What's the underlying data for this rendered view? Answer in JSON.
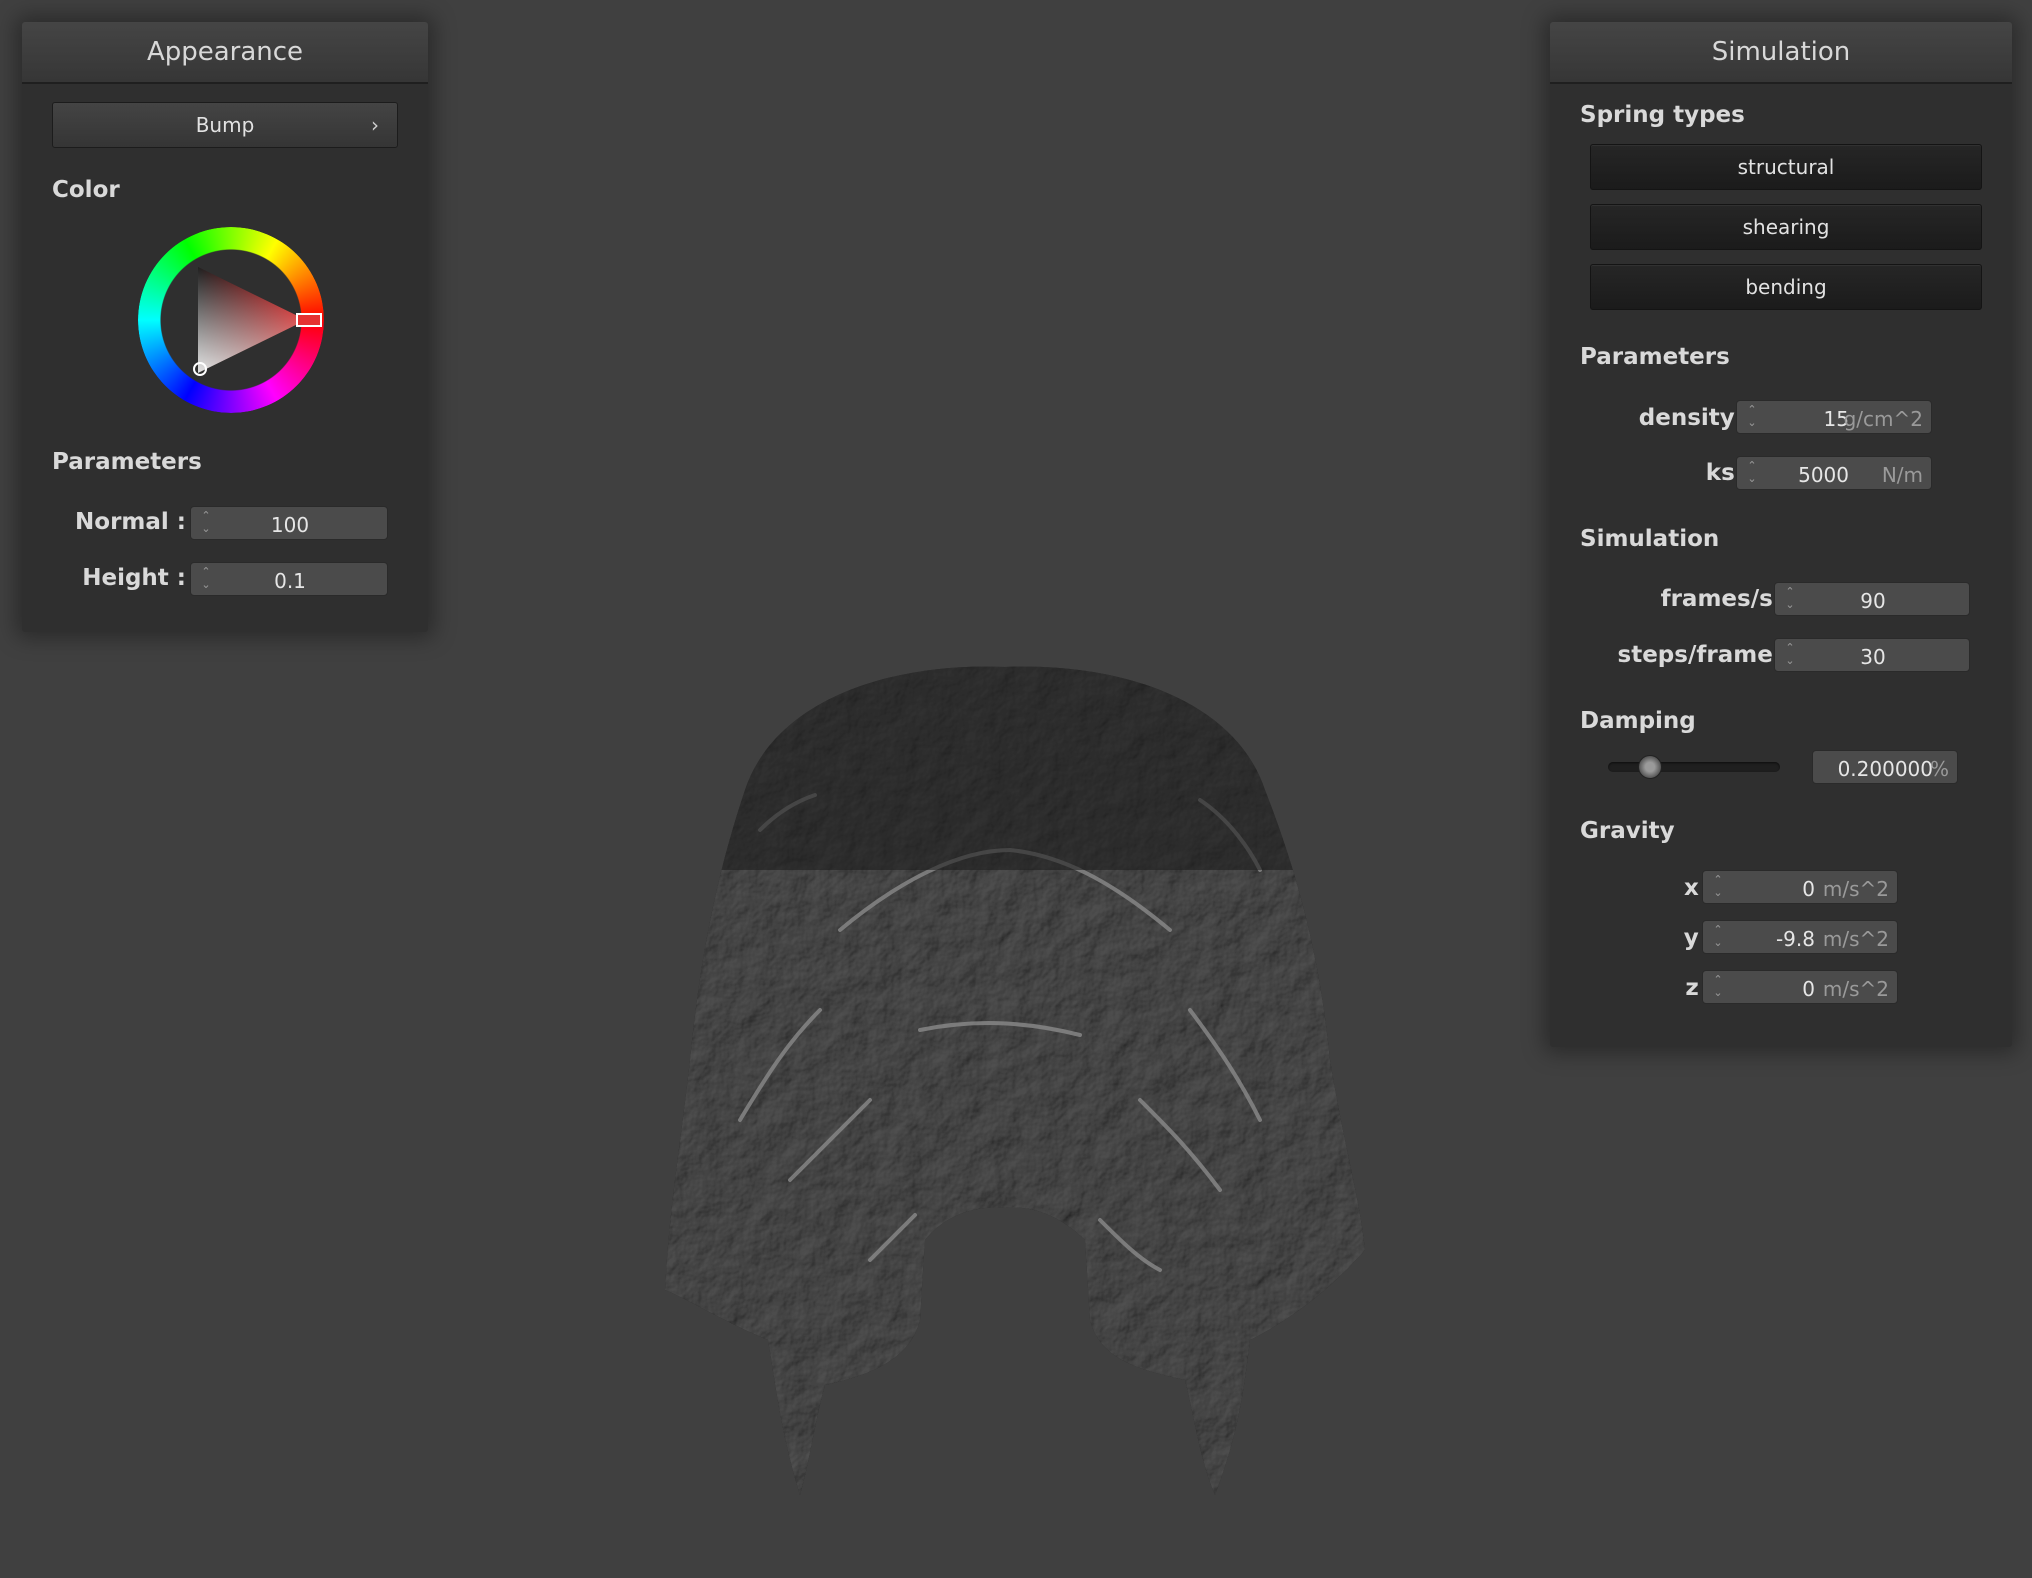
{
  "appearance": {
    "title": "Appearance",
    "mode_button": "Bump",
    "color_label": "Color",
    "params_label": "Parameters",
    "normal": {
      "label": "Normal :",
      "value": "100"
    },
    "height": {
      "label": "Height :",
      "value": "0.1"
    },
    "selected_color": "#e53232"
  },
  "simulation": {
    "title": "Simulation",
    "spring_types_label": "Spring types",
    "springs": [
      "structural",
      "shearing",
      "bending"
    ],
    "params_label": "Parameters",
    "density": {
      "label": "density :",
      "value": "15",
      "unit": "g/cm^2"
    },
    "ks": {
      "label": "ks :",
      "value": "5000",
      "unit": "N/m"
    },
    "sim_label": "Simulation",
    "fps": {
      "label": "frames/s :",
      "value": "90"
    },
    "steps": {
      "label": "steps/frame :",
      "value": "30"
    },
    "damping_label": "Damping",
    "damping": {
      "value": "0.200000",
      "unit": "%",
      "fraction": 0.2
    },
    "gravity_label": "Gravity",
    "gx": {
      "label": "x :",
      "value": "0",
      "unit": "m/s^2"
    },
    "gy": {
      "label": "y :",
      "value": "-9.8",
      "unit": "m/s^2"
    },
    "gz": {
      "label": "z :",
      "value": "0",
      "unit": "m/s^2"
    }
  },
  "viewport": {
    "object": "cloth-mesh",
    "background": "#404040"
  }
}
